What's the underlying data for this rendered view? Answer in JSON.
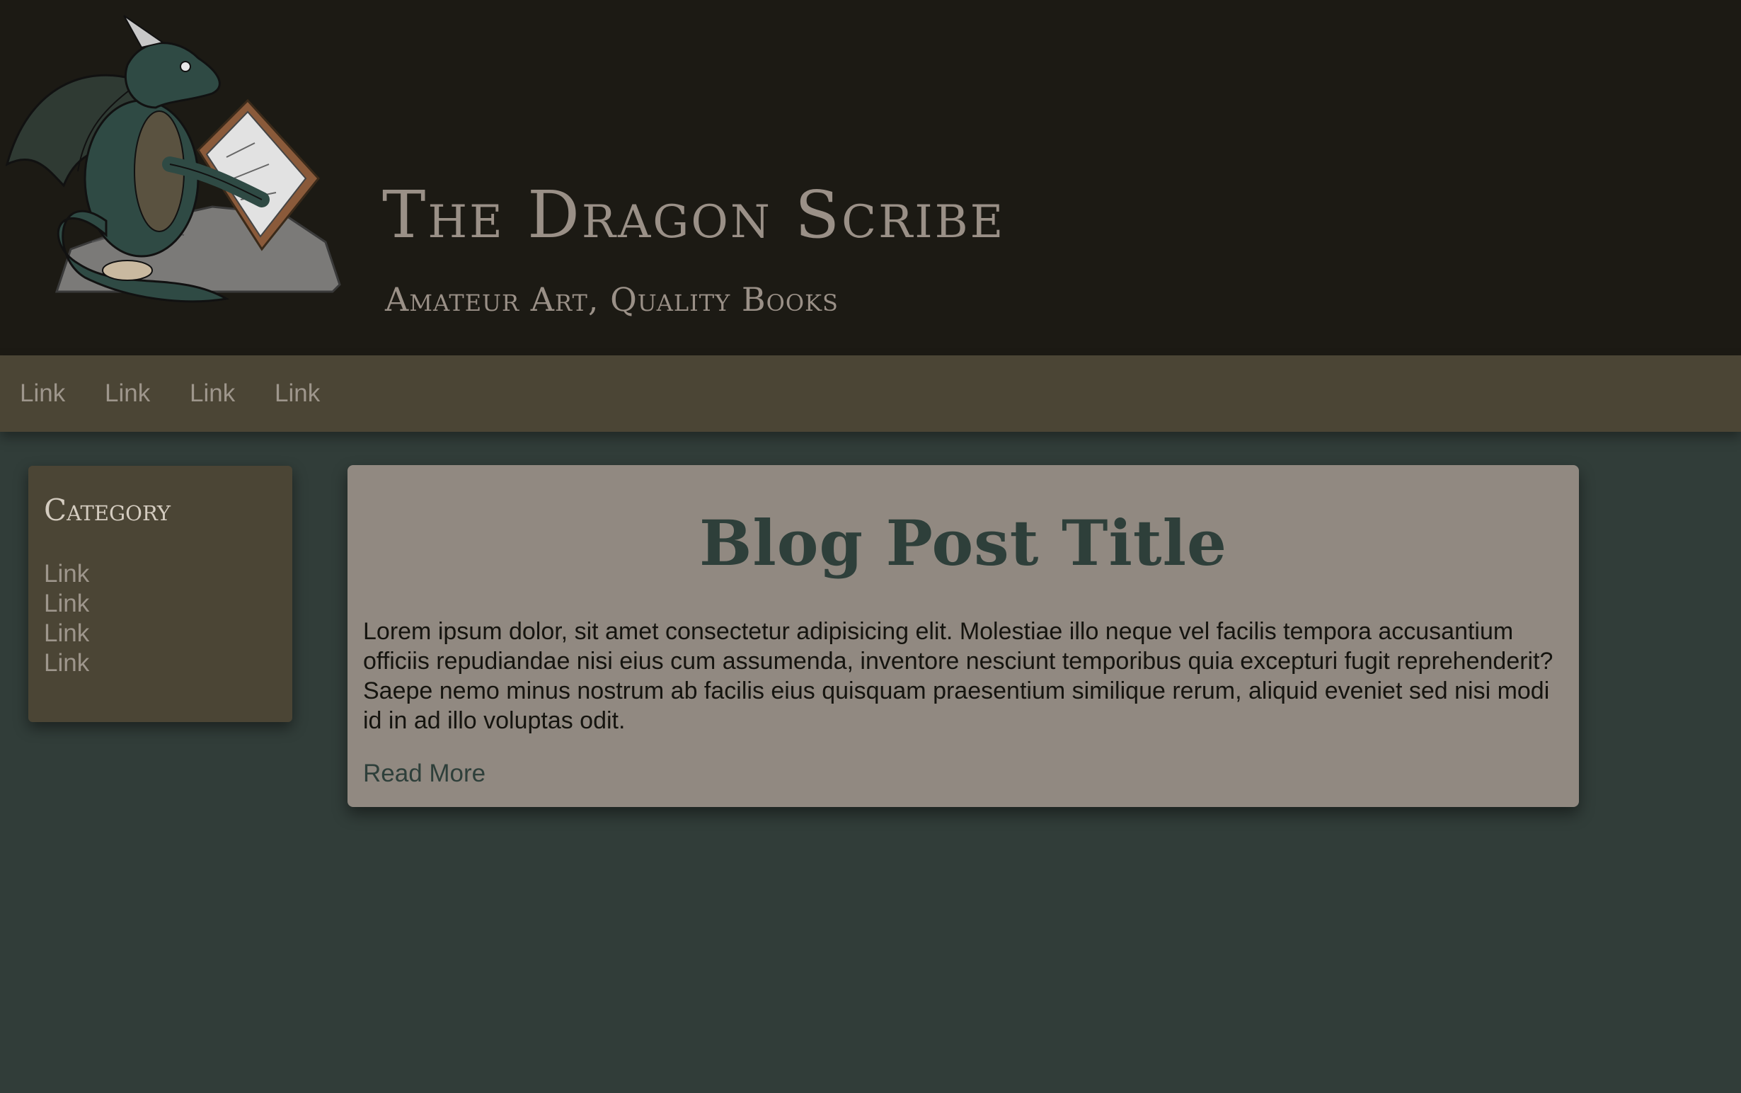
{
  "header": {
    "title": "The Dragon Scribe",
    "subtitle": "Amateur Art, Quality Books"
  },
  "nav": {
    "links": [
      "Link",
      "Link",
      "Link",
      "Link"
    ]
  },
  "sidebar": {
    "title": "Category",
    "links": [
      "Link",
      "Link",
      "Link",
      "Link"
    ]
  },
  "post": {
    "title": "Blog Post Title",
    "body": "Lorem ipsum dolor, sit amet consectetur adipisicing elit. Molestiae illo neque vel facilis tempora accusantium officiis repudiandae nisi eius cum assumenda, inventore nesciunt temporibus quia excepturi fugit reprehenderit? Saepe nemo minus nostrum ab facilis eius quisquam praesentium similique rerum, aliquid eveniet sed nisi modi id in ad illo voluptas odit.",
    "read_more": "Read More"
  },
  "colors": {
    "page_background": "#313d39",
    "header_background": "#1c1a14",
    "nav_background": "#4b4535",
    "card_background": "#918981",
    "accent_green": "#2e3f3a",
    "muted_text": "#9e968c"
  }
}
